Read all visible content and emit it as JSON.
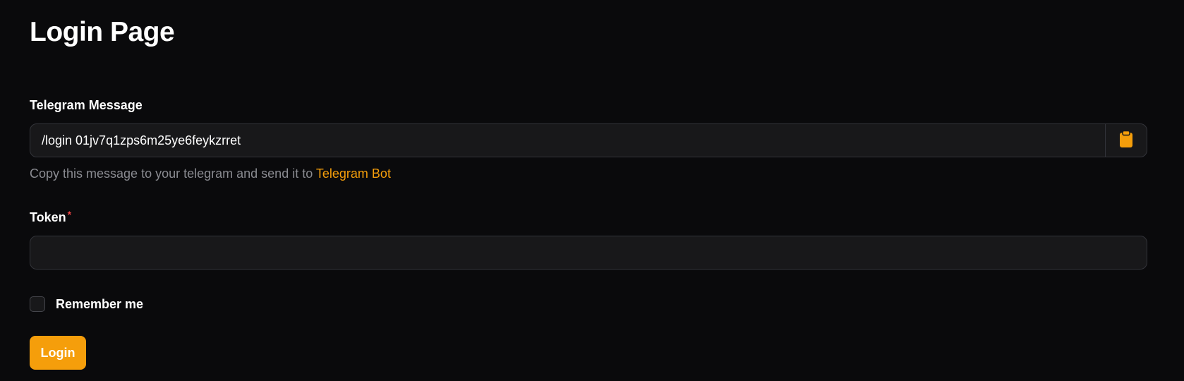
{
  "page": {
    "title": "Login Page"
  },
  "telegram_message": {
    "label": "Telegram Message",
    "value": "/login 01jv7q1zps6m25ye6feykzrret",
    "copy_icon": "clipboard-icon",
    "helper_text": "Copy this message to your telegram and send it to ",
    "helper_link": "Telegram Bot"
  },
  "token": {
    "label": "Token",
    "required_marker": "*",
    "value": "",
    "placeholder": ""
  },
  "remember_me": {
    "label": "Remember me",
    "checked": false
  },
  "login_button": {
    "label": "Login"
  },
  "colors": {
    "background": "#0a0a0c",
    "input_background": "#18181a",
    "accent": "#f59e0b",
    "required": "#ef4444",
    "muted_text": "#8a8b91"
  }
}
